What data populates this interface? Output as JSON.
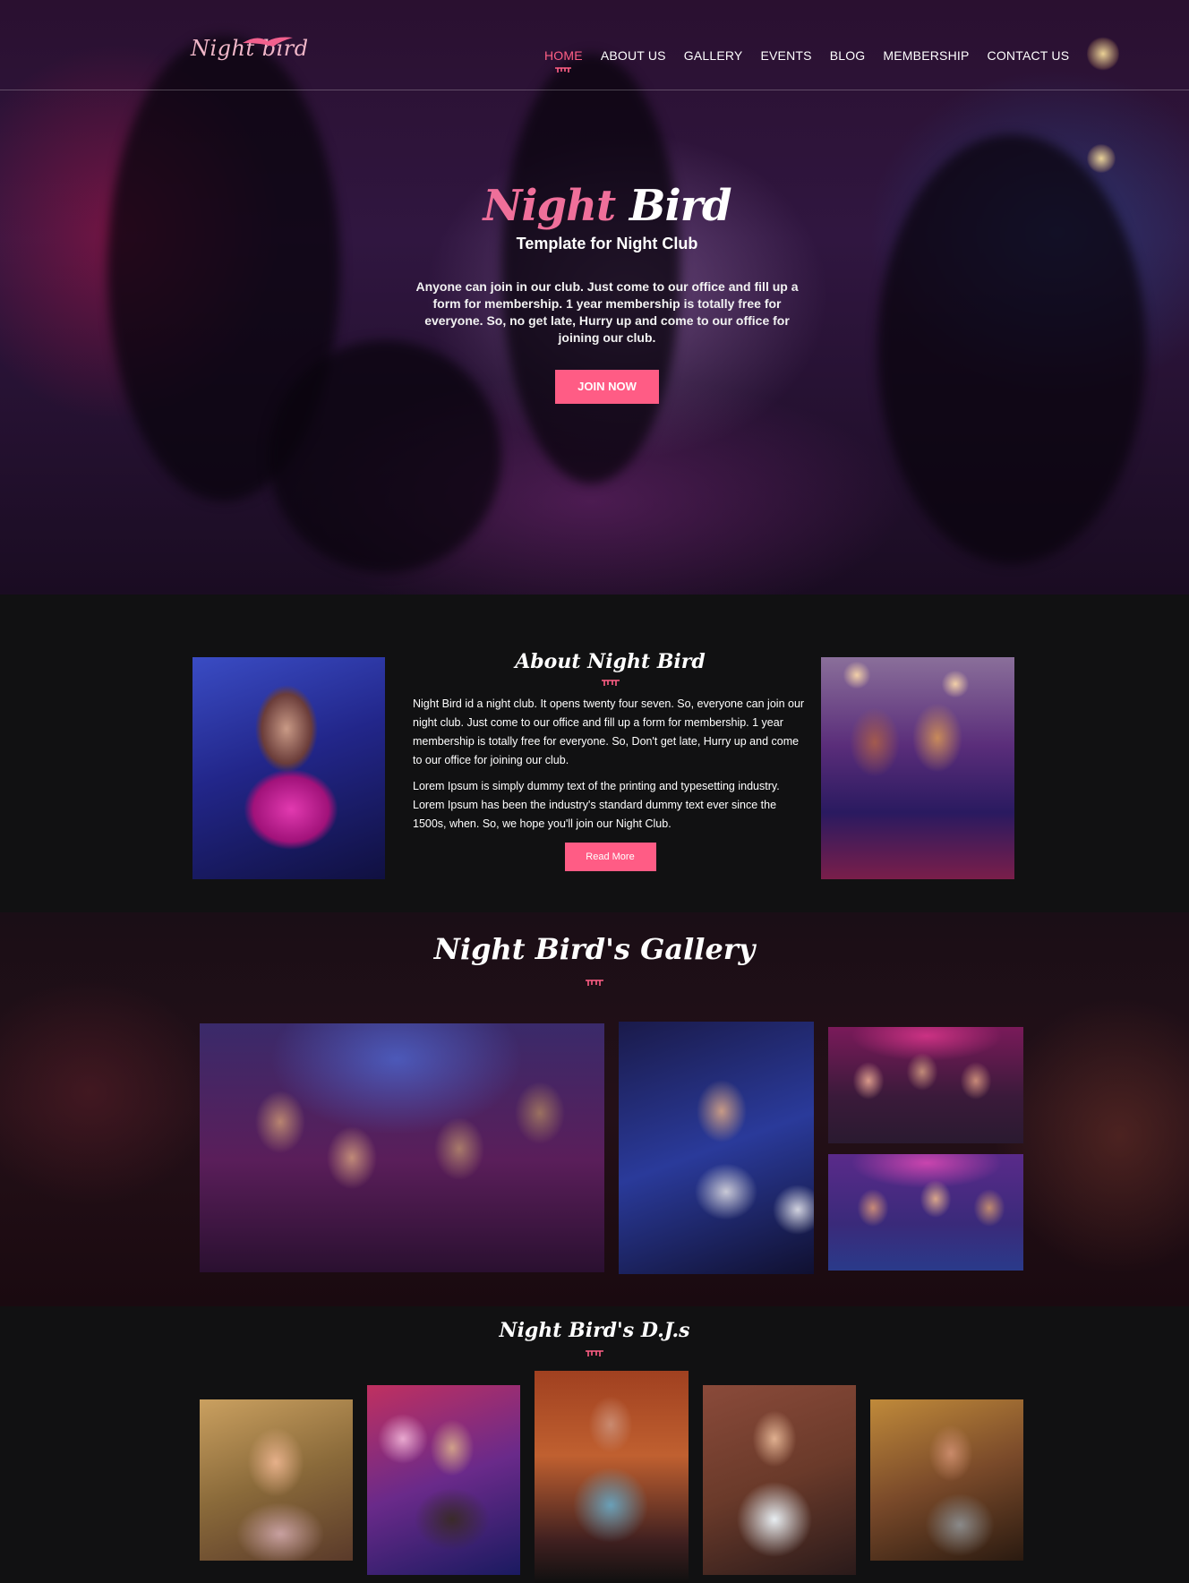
{
  "brand": {
    "logo_text": "Night bird",
    "accent_color": "#ff5f85"
  },
  "nav": {
    "items": [
      {
        "label": "HOME",
        "active": true
      },
      {
        "label": "ABOUT US",
        "active": false
      },
      {
        "label": "GALLERY",
        "active": false
      },
      {
        "label": "EVENTS",
        "active": false
      },
      {
        "label": "BLOG",
        "active": false
      },
      {
        "label": "MEMBERSHIP",
        "active": false
      },
      {
        "label": "CONTACT US",
        "active": false
      }
    ]
  },
  "hero": {
    "title_pink": "Night",
    "title_white": "Bird",
    "subtitle": "Template for Night Club",
    "text": "Anyone can join in our club. Just come to our office and fill up a form for membership. 1 year membership is totally free for everyone. So, no get late, Hurry up and come to our office for joining our club.",
    "button": "JOIN NOW"
  },
  "about": {
    "title": "About Night Bird",
    "paragraph_1": "Night Bird id a night club. It opens twenty four seven. So, everyone can join our night club. Just come to our office and fill up a form for membership. 1 year membership is totally free for everyone. So, Don't get late, Hurry up and come to our office for joining our club.",
    "paragraph_2": "Lorem Ipsum is simply dummy text of the printing and typesetting industry. Lorem Ipsum has been the industry's standard dummy text ever since the 1500s, when. So, we hope you'll join our Night Club.",
    "button": "Read More"
  },
  "gallery": {
    "title": "Night Bird's Gallery"
  },
  "djs": {
    "title": "Night Bird's D.J.s"
  },
  "icons": {
    "divider": "ornament-divider-icon",
    "logo_bird": "bird-logo-icon"
  }
}
